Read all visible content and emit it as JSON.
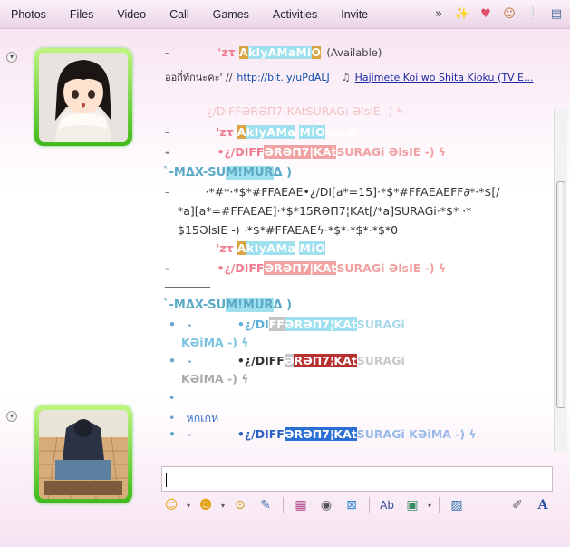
{
  "menu": [
    "Photos",
    "Files",
    "Video",
    "Call",
    "Games",
    "Activities",
    "Invite"
  ],
  "toolbar_icons": [
    "more-arrow-icon",
    "wand-icon",
    "heart-icon",
    "smiley-icon",
    "exclamation-icon",
    "window-menu-icon"
  ],
  "toolbar_glyphs": [
    "»",
    "✨",
    "♥",
    "☺",
    "❕",
    "▤"
  ],
  "contact": {
    "dash": "-",
    "nick_prefix": "'ᴢτ",
    "nick_a": "A",
    "nick_k": "kIyAMa",
    "nick_space": " ",
    "nick_m": "Mi",
    "nick_o": "O",
    "status": "(Available)",
    "psm_thai": "ออกี่ทักนะคะ' //",
    "psm_url": "http://bit.ly/uPdALJ",
    "psm_song": "Hajimete Koi wo Shita Kioku (TV E..."
  },
  "history": {
    "r0": "¿/DIFFƏRƏΠ7|KAtSURAGi  ƏlsIE -)  ϟ",
    "r1_dash": "-",
    "r1_a": "'ᴢτ",
    "r1_b": "A",
    "r1_c": "kIyAMa",
    "r1_d": "MiO",
    "r1_e": "said:",
    "r2_dash": "-",
    "r2_a": "•¿/DIFF",
    "r2_b": "ƏRƏΠ7|KAt",
    "r2_c": "SURAGi  ƏlsIE -)  ϟ",
    "sender1_a": "`-MΔX-SU",
    "sender1_b": "M!MUR",
    "sender1_c": "Δ )",
    "r3": "·*#*·*$*#FFAEAE•¿/DI[a*=15]·*$*#FFAEAEFF∂*·*$[/",
    "r4": "*a][a*=#FFAEAE]·*$*15RƏΠ7¦KAt[/*a]SURAGi·*$*  ·*",
    "r5": "$15ƏlsIE -)  ·*$*#FFAEAEϟ·*$*·*$*·*$*0",
    "r6_dash": "-",
    "r6_a": "'ᴢτ",
    "r6_b": "A",
    "r6_c": "kIyAMa",
    "r6_d": "MiO",
    "r7_dash": "-",
    "r7_a": "•¿/DIFF",
    "r7_b": "ƏRƏΠ7|KAt",
    "r7_c": "SURAGi  ƏlsIE -)  ϟ",
    "rule": "________",
    "sender2_a": "`-MΔX-SU",
    "sender2_b": "M!MUR",
    "sender2_c": "Δ )",
    "m1_dash": "-",
    "m1_a": "•¿/DI",
    "m1_b": "FF",
    "m1_c": "ƏRƏΠ7¦KAt",
    "m1_d": "SURAGi",
    "m1_line2": "KƏiMA -)  ϟ",
    "m2_dash": "-",
    "m2_a": "•¿/DIFF",
    "m2_b": "Ə",
    "m2_c": "RƏΠ7¦KAt",
    "m2_d": "SURAGi",
    "m2_line2": "KƏiMA -)  ϟ",
    "m3_thai": "หกเกห",
    "m4_dash": "-",
    "m4_a": "•¿/DIFF",
    "m4_b": "ƏRƏΠ7¦KAt",
    "m4_c": "SURAGi  KƏiMA -)  ϟ"
  },
  "format_icons": [
    "emoticon-icon",
    "wink-icon",
    "nudge-icon",
    "voice-clip-icon",
    "grid-icon",
    "sound-icon",
    "game-icon",
    "font-icon",
    "background-icon",
    "attach-icon",
    "handwriting-icon",
    "text-format-icon"
  ],
  "format_glyphs": [
    "☺",
    "☻",
    "⊙",
    "✎",
    "▦",
    "◉",
    "⊠",
    "Ab",
    "▣",
    "▨",
    "✐",
    "A"
  ],
  "colors": {
    "accent": "#2b6fd6",
    "pink": "#f1a3a3",
    "cyan": "#9fe0ee",
    "orange": "#d9a441"
  }
}
